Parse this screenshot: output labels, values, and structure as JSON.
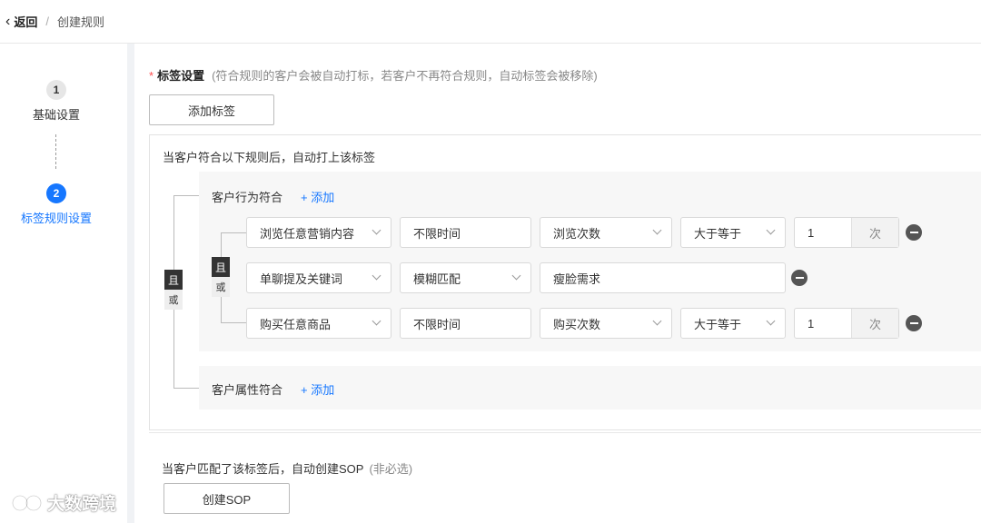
{
  "header": {
    "back_label": "返回",
    "separator": "/",
    "current": "创建规则"
  },
  "steps": [
    {
      "number": "1",
      "title": "基础设置",
      "state": "done"
    },
    {
      "number": "2",
      "title": "标签规则设置",
      "state": "active"
    }
  ],
  "tag_section": {
    "required_mark": "*",
    "title": "标签设置",
    "hint": "(符合规则的客户会被自动打标，若客户不再符合规则，自动标签会被移除)",
    "add_tag_button": "添加标签"
  },
  "rule_box": {
    "heading": "当客户符合以下规则后，自动打上该标签",
    "outer_logic": {
      "and": "且",
      "or": "或"
    },
    "behavior_group": {
      "title": "客户行为符合",
      "add_label": "+ 添加",
      "inner_logic": {
        "and": "且",
        "or": "或"
      },
      "rows": [
        {
          "field": "浏览任意营销内容",
          "time": "不限时间",
          "metric": "浏览次数",
          "operator": "大于等于",
          "value": "1",
          "unit": "次"
        },
        {
          "field": "单聊提及关键词",
          "match": "模糊匹配",
          "keyword": "瘦脸需求"
        },
        {
          "field": "购买任意商品",
          "time": "不限时间",
          "metric": "购买次数",
          "operator": "大于等于",
          "value": "1",
          "unit": "次"
        }
      ]
    },
    "attribute_group": {
      "title": "客户属性符合",
      "add_label": "+ 添加"
    }
  },
  "sop_section": {
    "hint": "当客户匹配了该标签后，自动创建SOP",
    "optional": "(非必选)",
    "button": "创建SOP"
  },
  "footer_brand": "大数跨境",
  "icons": {
    "back": "chevron-left-icon",
    "select": "chevron-down-icon",
    "remove": "minus-circle-icon",
    "brand": "brand-logo-icon"
  },
  "colors": {
    "accent": "#1677ff",
    "required": "#ff4d4f",
    "logic_badge": "#333333"
  }
}
